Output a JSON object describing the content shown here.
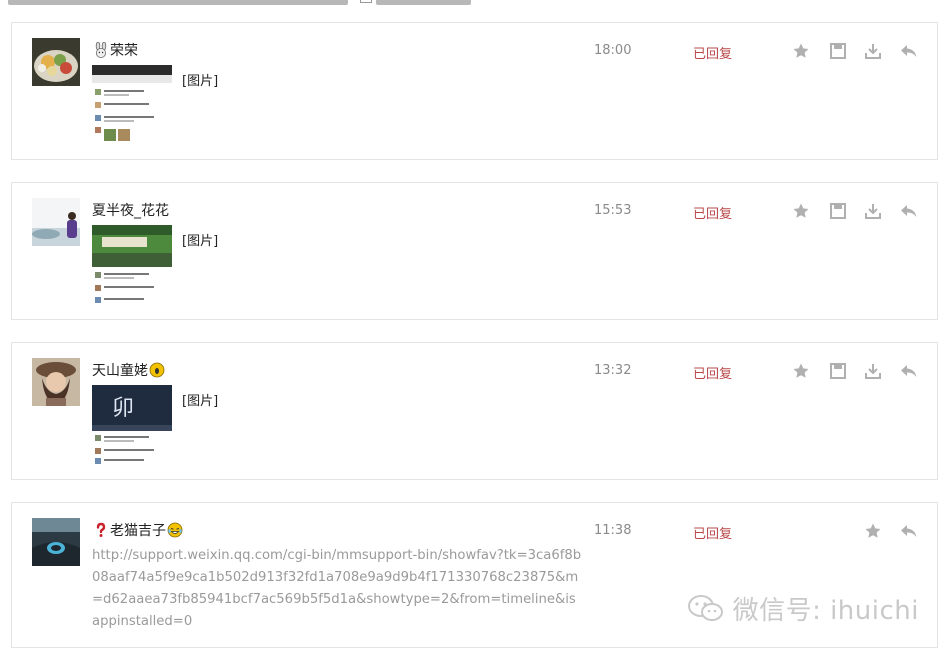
{
  "messages": [
    {
      "nickname": "荣荣",
      "nick_emoji": "bunny-emoji",
      "content_label": "[图片]",
      "time": "18:00",
      "status": "已回复"
    },
    {
      "nickname": "夏半夜_花花",
      "content_label": "[图片]",
      "time": "15:53",
      "status": "已回复"
    },
    {
      "nickname": "天山童姥",
      "nick_emoji": "face-emoji",
      "content_label": "[图片]",
      "time": "13:32",
      "status": "已回复"
    },
    {
      "nickname": "老猫吉子",
      "nick_prefix_emoji": "question-mark-emoji",
      "nick_emoji": "laughing-crying-emoji",
      "link": "http://support.weixin.qq.com/cgi-bin/mmsupport-bin/showfav?tk=3ca6f8b08aaf74a5f9e9ca1b502d913f32fd1a708e9a9d9b4f171330768c23875&m=d62aaea73fb85941bcf7ac569b5f5d1a&showtype=2&from=timeline&isappinstalled=0",
      "time": "11:38",
      "status": "已回复"
    }
  ],
  "icons": {
    "star": "star-icon",
    "save": "save-icon",
    "download": "download-icon",
    "reply": "reply-icon"
  },
  "watermark": {
    "text": "微信号: ihuichi"
  },
  "colors": {
    "status": "#b9484b",
    "time": "#8a8a8a",
    "icon": "#b0b0b0",
    "border": "#e4e4e4",
    "link": "#9a9a9a"
  }
}
